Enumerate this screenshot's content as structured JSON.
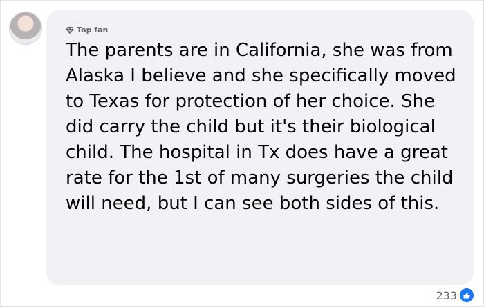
{
  "comment": {
    "badge_icon": "diamond-icon",
    "badge_label": "Top fan",
    "text": "The parents are in California, she was from Alaska I believe and she specifically moved to Texas for protection of her choice. She did carry the child but it's their biological child. The hospital in Tx does have a great rate for the 1st of many surgeries the child will need, but I can see both sides of this.",
    "reaction_count": "233",
    "reaction_icon": "like-icon",
    "colors": {
      "bubble": "#f0f2f5",
      "text": "#050505",
      "muted": "#65676b",
      "like": "#1877f2"
    }
  }
}
